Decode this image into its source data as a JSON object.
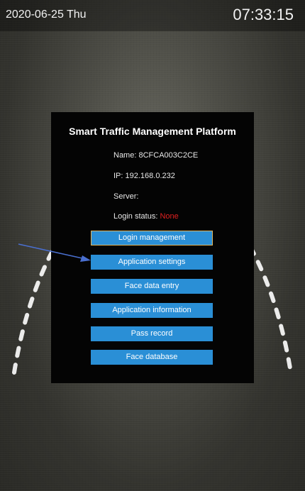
{
  "status_bar": {
    "date": "2020-06-25 Thu",
    "time": "07:33:15"
  },
  "panel": {
    "title": "Smart Traffic Management Platform",
    "name_label": "Name: ",
    "name_value": "8CFCA003C2CE",
    "ip_label": "IP: ",
    "ip_value": "192.168.0.232",
    "server_label": "Server:",
    "login_status_label": "Login status: ",
    "login_status_value": "None",
    "login_status_color": "#e02020"
  },
  "menu": {
    "login_management": "Login management",
    "application_settings": "Application settings",
    "face_data_entry": "Face data entry",
    "application_information": "Application information",
    "pass_record": "Pass record",
    "face_database": "Face database",
    "button_color": "#2a8fd6",
    "focus_border_color": "#e0b35a"
  },
  "annotation": {
    "arrow_color": "#4a6fd0",
    "arrow_target": "application_settings"
  }
}
